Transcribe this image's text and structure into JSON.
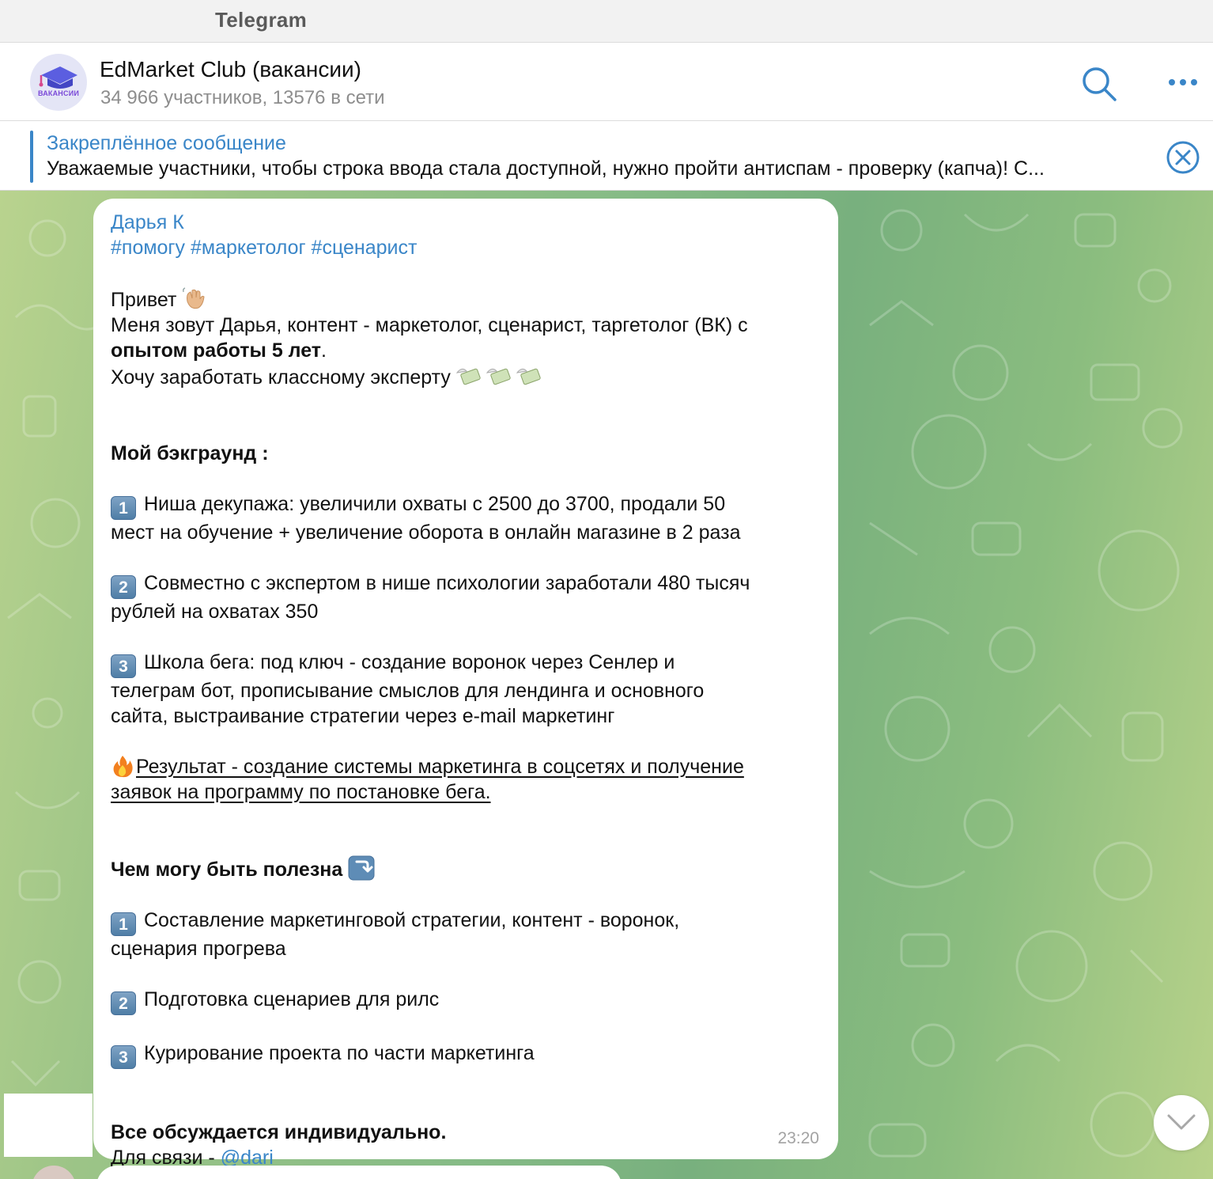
{
  "window": {
    "title": "Telegram"
  },
  "chat": {
    "name": "EdMarket Club (вакансии)",
    "subtitle": "34 966 участников, 13576 в сети",
    "avatar_text": "ВАКАНСИИ",
    "icons": {
      "search": "search-icon",
      "more": "more-dots-icon"
    }
  },
  "pinned": {
    "title": "Закреплённое сообщение",
    "text": "Уважаемые участники, чтобы строка ввода стала доступной, нужно пройти антиспам - проверку (капча)! С..."
  },
  "message": {
    "sender": "Дарья К",
    "tags": "#помогу #маркетолог #сценарист",
    "greeting": "Привет",
    "intro_1": "Меня зовут Дарья, контент - маркетолог, сценарист, таргетолог (ВК) с",
    "intro_2_bold": "опытом работы 5 лет",
    "intro_2_end": ".",
    "intro_3": "Хочу заработать классному эксперту",
    "background_title": "Мой бэкграунд :",
    "background_items": [
      {
        "num": "1",
        "lines": [
          "Ниша декупажа: увеличили охваты с 2500 до 3700, продали 50",
          "мест на обучение + увеличение оборота в онлайн магазине в 2 раза"
        ]
      },
      {
        "num": "2",
        "lines": [
          "Совместно с экспертом в нише психологии заработали 480 тысяч",
          "рублей на охватах 350"
        ]
      },
      {
        "num": "3",
        "lines": [
          "Школа бега: под ключ - создание воронок через Сенлер и",
          "телеграм бот, прописывание смыслов для лендинга и основного",
          "сайта, выстраивание стратегии через e-mail маркетинг"
        ]
      }
    ],
    "result_line_1": "Результат - создание системы маркетинга в соцсетях и получение ",
    "result_line_2": "заявок на программу по постановке бега. ",
    "useful_title": "Чем могу быть полезна",
    "useful_items": [
      {
        "num": "1",
        "lines": [
          "Составление маркетинговой стратегии, контент - воронок,",
          "сценария прогрева"
        ]
      },
      {
        "num": "2",
        "lines": [
          "Подготовка сценариев для рилс"
        ]
      },
      {
        "num": "3",
        "lines": [
          "Курирование проекта по части маркетинга"
        ]
      }
    ],
    "closing_bold": "Все обсуждается индивидуально.",
    "contact_prefix": "Для связи - ",
    "contact_handle": "@dari_",
    "time": "23:20",
    "emoji_names": [
      "waving-hand-emoji",
      "money-with-wings-emoji",
      "fire-emoji",
      "arrow-down-keycap-emoji"
    ]
  },
  "colors": {
    "accent": "#3a86c8",
    "bubble": "#ffffff",
    "wallpaper": "#86bb86"
  }
}
